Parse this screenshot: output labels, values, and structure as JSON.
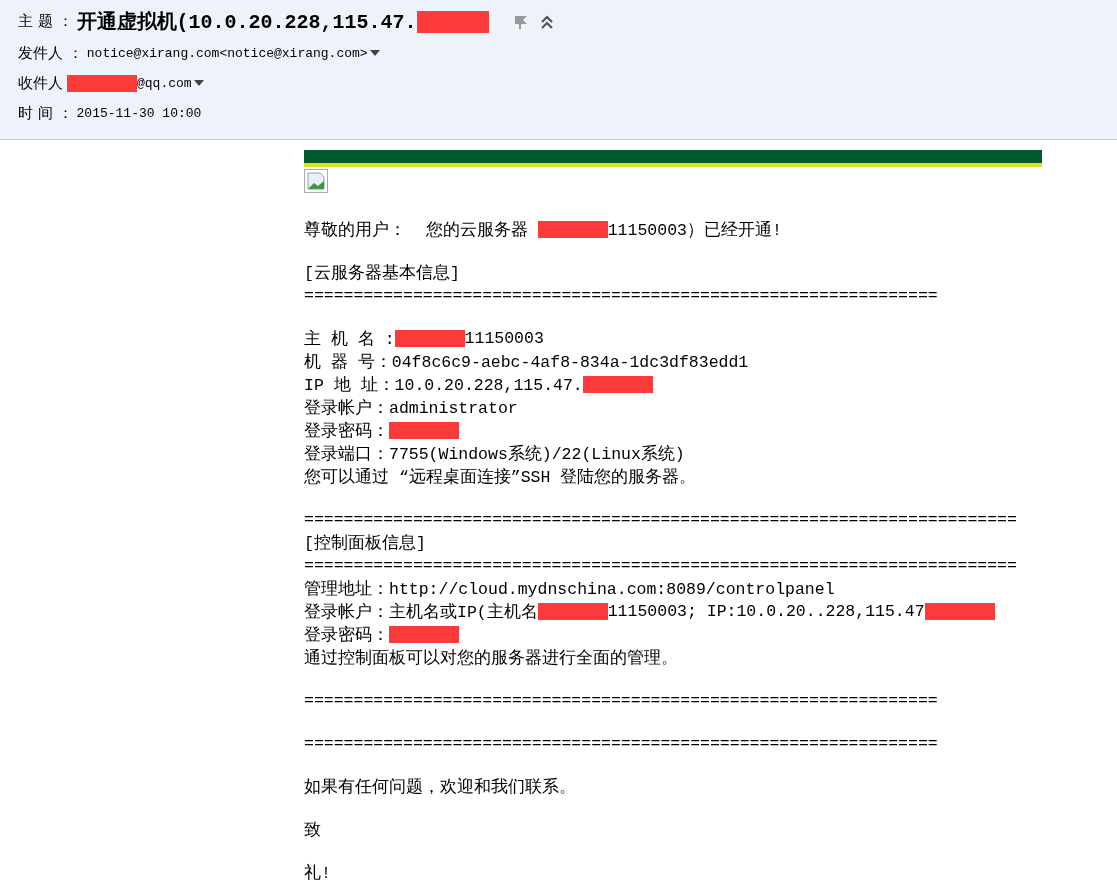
{
  "header": {
    "subject": {
      "label": "主 题 ：",
      "parts": [
        {
          "kind": "text",
          "text": "开通虚拟机(10.0.20.228,115.47."
        },
        {
          "kind": "redaction"
        }
      ]
    },
    "sender": {
      "label": "发件人 ：",
      "parts": [
        {
          "kind": "text",
          "text": "notice@xirang.com<notice@xirang.com>"
        }
      ]
    },
    "recipient": {
      "label": "收件人",
      "parts": [
        {
          "kind": "redaction"
        },
        {
          "kind": "text",
          "text": "@qq.com"
        }
      ]
    },
    "time": {
      "label": "时 间 ：",
      "parts": [
        {
          "kind": "text",
          "text": "2015-11-30 10:00"
        }
      ]
    }
  },
  "body": {
    "paragraphs": [
      [
        [
          {
            "kind": "text",
            "text": "尊敬的用户：  您的云服务器 "
          },
          {
            "kind": "redaction"
          },
          {
            "kind": "text",
            "text": "11150003）已经开通!"
          }
        ]
      ],
      [
        [
          {
            "kind": "text",
            "text": "[云服务器基本信息]"
          }
        ],
        [
          {
            "kind": "text",
            "text": "================================================================"
          }
        ]
      ],
      [
        [
          {
            "kind": "text",
            "text": "主 机 名 :"
          },
          {
            "kind": "redaction"
          },
          {
            "kind": "text",
            "text": "11150003"
          }
        ],
        [
          {
            "kind": "text",
            "text": "机 器 号：04f8c6c9-aebc-4af8-834a-1dc3df83edd1"
          }
        ],
        [
          {
            "kind": "text",
            "text": "IP 地 址：10.0.20.228,115.47."
          },
          {
            "kind": "redaction"
          }
        ],
        [
          {
            "kind": "text",
            "text": "登录帐户：administrator"
          }
        ],
        [
          {
            "kind": "text",
            "text": "登录密码："
          },
          {
            "kind": "redaction"
          }
        ],
        [
          {
            "kind": "text",
            "text": "登录端口：7755(Windows系统)/22(Linux系统)"
          }
        ],
        [
          {
            "kind": "text",
            "text": "您可以通过 “远程桌面连接”SSH 登陆您的服务器。"
          }
        ]
      ],
      [
        [
          {
            "kind": "text",
            "text": "========================================================================"
          }
        ],
        [
          {
            "kind": "text",
            "text": "[控制面板信息]"
          }
        ],
        [
          {
            "kind": "text",
            "text": "========================================================================"
          }
        ],
        [
          {
            "kind": "text",
            "text": "管理地址：http://cloud.mydnschina.com:8089/controlpanel"
          }
        ],
        [
          {
            "kind": "text",
            "text": "登录帐户：主机名或IP(主机名"
          },
          {
            "kind": "redaction"
          },
          {
            "kind": "text",
            "text": "11150003; IP:10.0.20..228,115.47"
          },
          {
            "kind": "redaction"
          }
        ],
        [
          {
            "kind": "text",
            "text": "登录密码："
          },
          {
            "kind": "redaction"
          }
        ],
        [
          {
            "kind": "text",
            "text": "通过控制面板可以对您的服务器进行全面的管理。"
          }
        ]
      ],
      [
        [
          {
            "kind": "text",
            "text": "================================================================"
          }
        ]
      ],
      [
        [
          {
            "kind": "text",
            "text": "================================================================"
          }
        ]
      ],
      [
        [
          {
            "kind": "text",
            "text": "如果有任何问题，欢迎和我们联系。"
          }
        ]
      ],
      [
        [
          {
            "kind": "text",
            "text": "致"
          }
        ]
      ],
      [
        [
          {
            "kind": "text",
            "text": "礼!"
          }
        ]
      ]
    ]
  }
}
